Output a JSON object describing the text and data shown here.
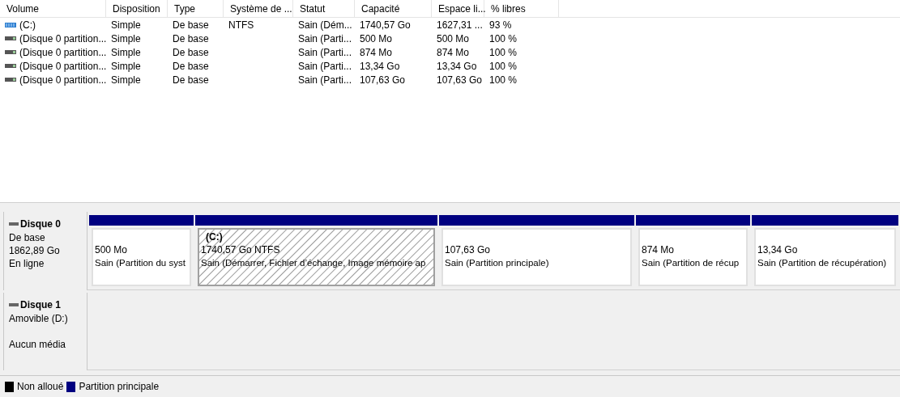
{
  "table": {
    "columns": [
      "Volume",
      "Disposition",
      "Type",
      "Système de ...",
      "Statut",
      "Capacité",
      "Espace li...",
      "% libres"
    ],
    "rows": [
      {
        "kind": "system",
        "cells": [
          "(C:)",
          "Simple",
          "De base",
          "NTFS",
          "Sain (Dém...",
          "1740,57 Go",
          "1627,31 ...",
          "93 %"
        ]
      },
      {
        "kind": "partition",
        "cells": [
          "(Disque 0 partition...",
          "Simple",
          "De base",
          "",
          "Sain (Parti...",
          "500 Mo",
          "500 Mo",
          "100 %"
        ]
      },
      {
        "kind": "partition",
        "cells": [
          "(Disque 0 partition...",
          "Simple",
          "De base",
          "",
          "Sain (Parti...",
          "874 Mo",
          "874 Mo",
          "100 %"
        ]
      },
      {
        "kind": "partition",
        "cells": [
          "(Disque 0 partition...",
          "Simple",
          "De base",
          "",
          "Sain (Parti...",
          "13,34 Go",
          "13,34 Go",
          "100 %"
        ]
      },
      {
        "kind": "partition",
        "cells": [
          "(Disque 0 partition...",
          "Simple",
          "De base",
          "",
          "Sain (Parti...",
          "107,63 Go",
          "107,63 Go",
          "100 %"
        ]
      }
    ]
  },
  "disks": [
    {
      "name": "Disque 0",
      "type": "De base",
      "size": "1862,89 Go",
      "state": "En ligne",
      "partitions": [
        {
          "selected": false,
          "size": "500 Mo",
          "status": "Sain (Partition du syst"
        },
        {
          "selected": true,
          "title": "(C:)",
          "size": "1740,57 Go NTFS",
          "status": "Sain (Démarrer, Fichier d’échange, Image mémoire ap"
        },
        {
          "selected": false,
          "size": "107,63 Go",
          "status": "Sain (Partition principale)"
        },
        {
          "selected": false,
          "size": "874 Mo",
          "status": "Sain (Partition de récup"
        },
        {
          "selected": false,
          "size": "13,34 Go",
          "status": "Sain (Partition de récupération)"
        }
      ]
    },
    {
      "name": "Disque 1",
      "type": "Amovible (D:)",
      "state": "Aucun média"
    }
  ],
  "legend": [
    {
      "label": "Non alloué",
      "color": "#000000"
    },
    {
      "label": "Partition principale",
      "color": "#000080"
    }
  ]
}
